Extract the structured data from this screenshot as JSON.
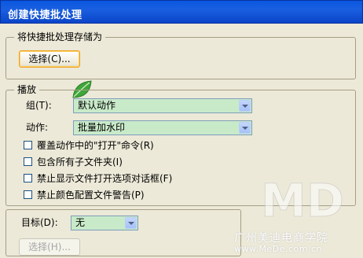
{
  "window": {
    "title": "创建快捷批处理"
  },
  "save_group": {
    "legend": "将快捷批处理存储为",
    "choose_button": "选择(C)..."
  },
  "play_group": {
    "legend": "播放",
    "set_label": "组(T):",
    "set_value": "默认动作",
    "action_label": "动作:",
    "action_value": "批量加水印",
    "checkboxes": [
      {
        "label": "覆盖动作中的\"打开\"命令(R)",
        "checked": false
      },
      {
        "label": "包含所有子文件夹(I)",
        "checked": false
      },
      {
        "label": "禁止显示文件打开选项对话框(F)",
        "checked": false
      },
      {
        "label": "禁止颜色配置文件警告(P)",
        "checked": false
      }
    ]
  },
  "destination": {
    "label": "目标(D):",
    "value": "无",
    "choose_button": "选择(H)..."
  },
  "watermark": {
    "org": "广州美迪电商学院",
    "url": "www.MeDe.com.cn",
    "logo_text": "MD"
  },
  "colors": {
    "titlebar": "#0a57e0",
    "select_bg": "#c9eac9",
    "dialog_bg": "#ece9d8"
  }
}
